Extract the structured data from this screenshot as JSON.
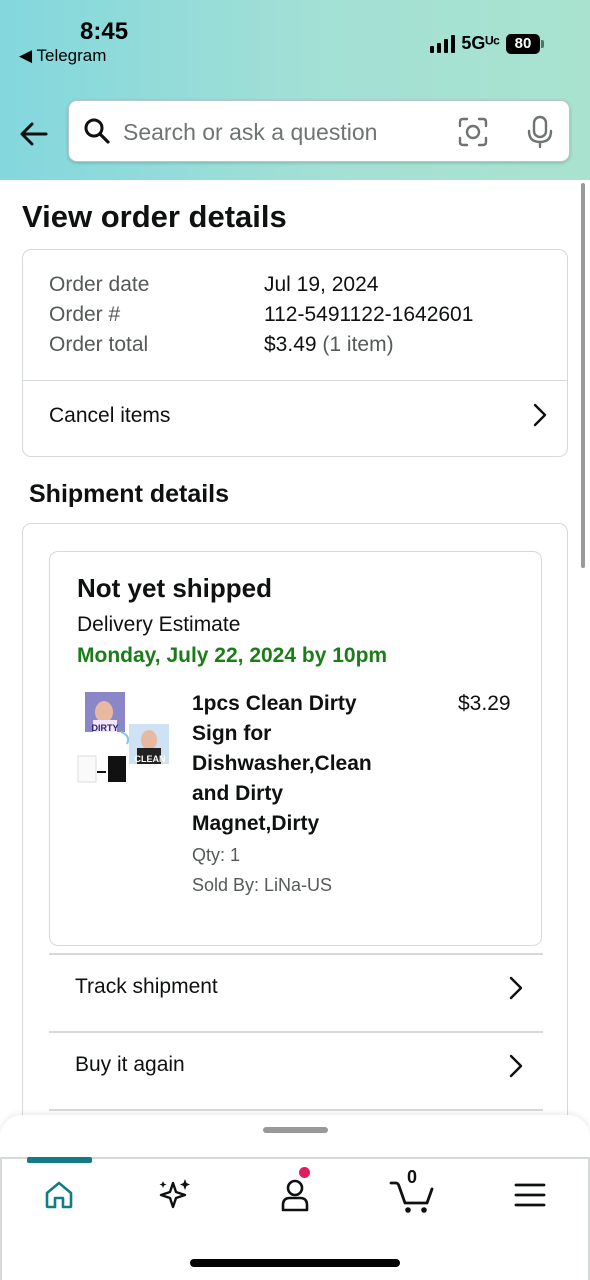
{
  "status_bar": {
    "time": "8:45",
    "back_app": "◀ Telegram",
    "network": "5Gᵁᶜ",
    "battery": "80"
  },
  "search": {
    "placeholder": "Search or ask a question"
  },
  "page": {
    "title": "View order details"
  },
  "order": {
    "date_label": "Order date",
    "date_value": "Jul 19, 2024",
    "number_label": "Order #",
    "number_value": "112-5491122-1642601",
    "total_label": "Order total",
    "total_value": "$3.49",
    "total_items": "(1 item)",
    "cancel_label": "Cancel items"
  },
  "shipment": {
    "section_title": "Shipment details",
    "status": "Not yet shipped",
    "estimate_label": "Delivery Estimate",
    "estimate_date": "Monday, July 22, 2024 by 10pm",
    "product": {
      "title": "1pcs Clean Dirty Sign for Dishwasher,Clean and Dirty Magnet,Dirty",
      "price": "$3.29",
      "qty": "Qty: 1",
      "sold_by": "Sold By: LiNa-US",
      "thumb_text_dirty": "DIRTY",
      "thumb_text_clean": "CLEAN"
    },
    "actions": [
      {
        "label": "Track shipment"
      },
      {
        "label": "Buy it again"
      }
    ]
  },
  "bottom_nav": {
    "cart_count": "0",
    "items": [
      "home-icon",
      "sparkle-icon",
      "account-icon",
      "cart-icon",
      "menu-icon"
    ],
    "active_color": "#137a86"
  },
  "colors": {
    "delivery_green": "#1b7d17",
    "header_gradient_start": "#83d7dd",
    "header_gradient_end": "#a9e3cf",
    "notification_dot": "#e5195e"
  }
}
